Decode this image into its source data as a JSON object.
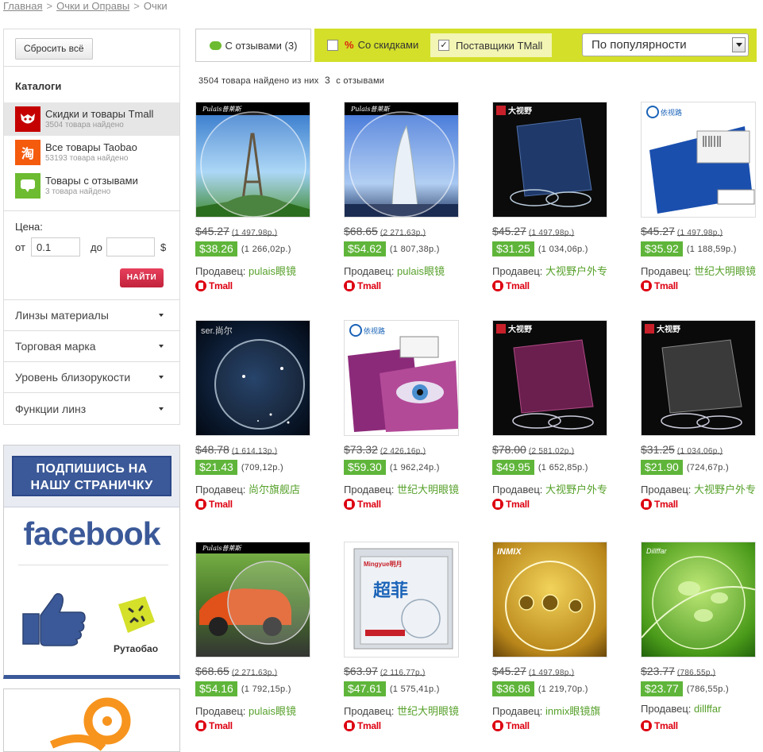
{
  "breadcrumb": {
    "home": "Главная",
    "sep": ">",
    "section": "Очки и Оправы",
    "current": "Очки"
  },
  "sidebar": {
    "reset_label": "Сбросить всё",
    "catalogs_title": "Каталоги",
    "catalogs": [
      {
        "title": "Скидки и товары Tmall",
        "count": "3504 товара найдено",
        "icon": "tmall-cat-icon",
        "active": true
      },
      {
        "title": "Все товары Taobao",
        "count": "53193 товара найдено",
        "icon": "taobao-icon",
        "glyph": "淘"
      },
      {
        "title": "Товары с отзывами",
        "count": "3 товара найдено",
        "icon": "review-bubble-icon"
      }
    ],
    "price": {
      "label": "Цена:",
      "from_label": "от",
      "from_value": "0.1",
      "to_label": "до",
      "to_value": "",
      "currency": "$",
      "find_label": "НАЙТИ"
    },
    "filters": [
      "Линзы материалы",
      "Торговая марка",
      "Уровень близорукости",
      "Функции линз"
    ]
  },
  "promo": {
    "banner_line1": "ПОДПИШИСЬ НА",
    "banner_line2": "НАШУ СТРАНИЧКУ",
    "logo": "facebook",
    "brand": "Рутаобао"
  },
  "toolbar": {
    "reviews_tab": "С отзывами (3)",
    "discount_pct": "%",
    "discount_label": "Со скидками",
    "discount_checked": false,
    "tmall_label": "Поставщики TMall",
    "tmall_checked": true,
    "sort_value": "По популярности"
  },
  "results": {
    "count": "3504",
    "text1": "товара найдено из них",
    "with_reviews": "3",
    "text2": "с отзывами"
  },
  "seller_label": "Продавец:",
  "tmall_badge": "Tmall",
  "products": [
    {
      "old_price": "$45.27",
      "old_rub": "(1 497,98р.)",
      "price": "$38.26",
      "rub": "(1 266,02р.)",
      "seller": "pulais眼镜",
      "brand_mark": "Pulais普莱斯",
      "image": "eiffel-lens-image"
    },
    {
      "old_price": "$68.65",
      "old_rub": "(2 271,63р.)",
      "price": "$54.62",
      "rub": "(1 807,38р.)",
      "seller": "pulais眼镜",
      "brand_mark": "Pulais普莱斯",
      "image": "burj-lens-image"
    },
    {
      "old_price": "$45.27",
      "old_rub": "(1 497,98р.)",
      "price": "$31.25",
      "rub": "(1 034,06р.)",
      "seller": "大视野户外专",
      "brand_mark": "大视野",
      "image": "dashiye-lens-image"
    },
    {
      "old_price": "$45.27",
      "old_rub": "(1 497,98р.)",
      "price": "$35.92",
      "rub": "(1 188,59р.)",
      "seller": "世纪大明眼镜",
      "brand_mark": "依视路",
      "image": "essilor-box-image"
    },
    {
      "old_price": "$48.78",
      "old_rub": "(1 614,13р.)",
      "price": "$21.43",
      "rub": "(709,12р.)",
      "seller": "尚尔旗舰店",
      "brand_mark": "ser.尚尔",
      "image": "ser-lens-image"
    },
    {
      "old_price": "$73.32",
      "old_rub": "(2 426,16р.)",
      "price": "$59.30",
      "rub": "(1 962,24р.)",
      "seller": "世纪大明眼镜",
      "brand_mark": "依视路",
      "image": "crizal-box-image"
    },
    {
      "old_price": "$78.00",
      "old_rub": "(2 581,02р.)",
      "price": "$49.95",
      "rub": "(1 652,85р.)",
      "seller": "大视野户外专",
      "brand_mark": "大视野",
      "image": "dashiye-pink-lens-image"
    },
    {
      "old_price": "$31.25",
      "old_rub": "(1 034,06р.)",
      "price": "$21.90",
      "rub": "(724,67р.)",
      "seller": "大视野户外专",
      "brand_mark": "大视野",
      "image": "dashiye-gray-lens-image"
    },
    {
      "old_price": "$68.65",
      "old_rub": "(2 271,63р.)",
      "price": "$54.16",
      "rub": "(1 792,15р.)",
      "seller": "pulais眼镜",
      "brand_mark": "Pulais普莱斯",
      "image": "car-lens-image"
    },
    {
      "old_price": "$63.97",
      "old_rub": "(2 116,77р.)",
      "price": "$47.61",
      "rub": "(1 575,41р.)",
      "seller": "世纪大明眼镜",
      "brand_mark": "Mingyue明月",
      "image": "mingyue-box-image"
    },
    {
      "old_price": "$45.27",
      "old_rub": "(1 497,98р.)",
      "price": "$36.86",
      "rub": "(1 219,70р.)",
      "seller": "inmix眼镜旗",
      "brand_mark": "INMIX",
      "image": "inmix-drops-image"
    },
    {
      "old_price": "$23.77",
      "old_rub": "(786,55р.)",
      "price": "$23.77",
      "rub": "(786,55р.)",
      "seller": "dillffar",
      "brand_mark": "Dillffar",
      "image": "leaf-drops-image"
    }
  ]
}
